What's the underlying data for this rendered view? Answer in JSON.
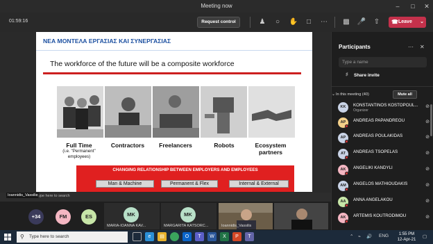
{
  "window": {
    "title": "Meeting now",
    "minimize_icon": "minimize-icon",
    "maximize_icon": "maximize-icon",
    "close_icon": "close-icon"
  },
  "toolbar": {
    "timer": "01:59:16",
    "request_control": "Request control",
    "leave": "Leave",
    "icons": [
      "participants-icon",
      "chat-icon",
      "raise-hand-icon",
      "more-icon",
      "share-tray-icon",
      "camera-icon",
      "mic-muted-icon",
      "share-icon",
      "hangup-icon"
    ]
  },
  "slide": {
    "heading": "ΝΕΑ ΜΟΝΤΕΛΑ ΕΡΓΑΣΙΑΣ ΚΑΙ ΣΥΝΕΡΓΑΣΙΑΣ",
    "title": "The workforce of the future will be a composite workforce",
    "columns": [
      {
        "label": "Full Time",
        "sub": "(i.e. \"Permanent\" employees)"
      },
      {
        "label": "Contractors",
        "sub": ""
      },
      {
        "label": "Freelancers",
        "sub": ""
      },
      {
        "label": "Robots",
        "sub": ""
      },
      {
        "label": "Ecosystem partners",
        "sub": ""
      }
    ],
    "banner": "CHANGING RELATIONSHIP BETWEEN EMPLOYERS AND EMPLOYEES",
    "chips": [
      "Man & Machine",
      "Permanent & Flex",
      "Internal & External"
    ]
  },
  "presenter": {
    "name": "Ioannidis_Vassilis",
    "shared_taskbar_search": "Type here to search"
  },
  "gallery": {
    "overflow": "+34",
    "avatars": [
      {
        "initials": "FM",
        "color": "#f4b6c2"
      },
      {
        "initials": "ES",
        "color": "#c7e6a8"
      }
    ],
    "tiles": [
      {
        "initials": "MK",
        "name": "MARIA-IOANNA KAV...",
        "color": "#b8e0c8"
      },
      {
        "initials": "MK",
        "name": "MARGARITA KATSORC...",
        "color": "#b8e0c8"
      }
    ],
    "video_names": [
      "Ioannidis_Vassilis",
      ""
    ]
  },
  "participants": {
    "title": "Participants",
    "search_placeholder": "Type a name",
    "share_invite": "Share invite",
    "in_meeting": "In this meeting (40)",
    "mute_all": "Mute all",
    "list": [
      {
        "initials": "KK",
        "name": "KONSTANTINOS KOSTOPOUL...",
        "role": "Organizer",
        "color": "#c9d3e6"
      },
      {
        "initials": "AP",
        "name": "ANDREAS PAPANDREOU",
        "role": "",
        "color": "#f3d08a"
      },
      {
        "initials": "AP",
        "name": "ANDREAS POULAKIDAS",
        "role": "",
        "color": "#c9d3e6"
      },
      {
        "initials": "AT",
        "name": "ANDREAS TSOPELAS",
        "role": "",
        "color": "#c9d3e6"
      },
      {
        "initials": "AK",
        "name": "ANGELIKI KANDYLI",
        "role": "",
        "color": "#f4b6c2"
      },
      {
        "initials": "AM",
        "name": "ANGELOS MATHIOUDAKIS",
        "role": "",
        "color": "#c9d3e6"
      },
      {
        "initials": "AA",
        "name": "ANNA ANGELAKOU",
        "role": "",
        "color": "#c7e6a8"
      },
      {
        "initials": "AK",
        "name": "ARTEMIS KOUTRODIMOU",
        "role": "",
        "color": "#f4b6c2"
      }
    ]
  },
  "taskbar": {
    "search": "Type here to search",
    "apps": [
      "task-view-icon",
      "edge-icon",
      "file-explorer-icon",
      "chrome-icon",
      "outlook-icon",
      "teams-icon",
      "word-icon",
      "excel-icon",
      "powerpoint-icon",
      "teams-chat-icon"
    ],
    "language": "ENG",
    "time": "1:55 PM",
    "date": "12-Apr-21"
  }
}
